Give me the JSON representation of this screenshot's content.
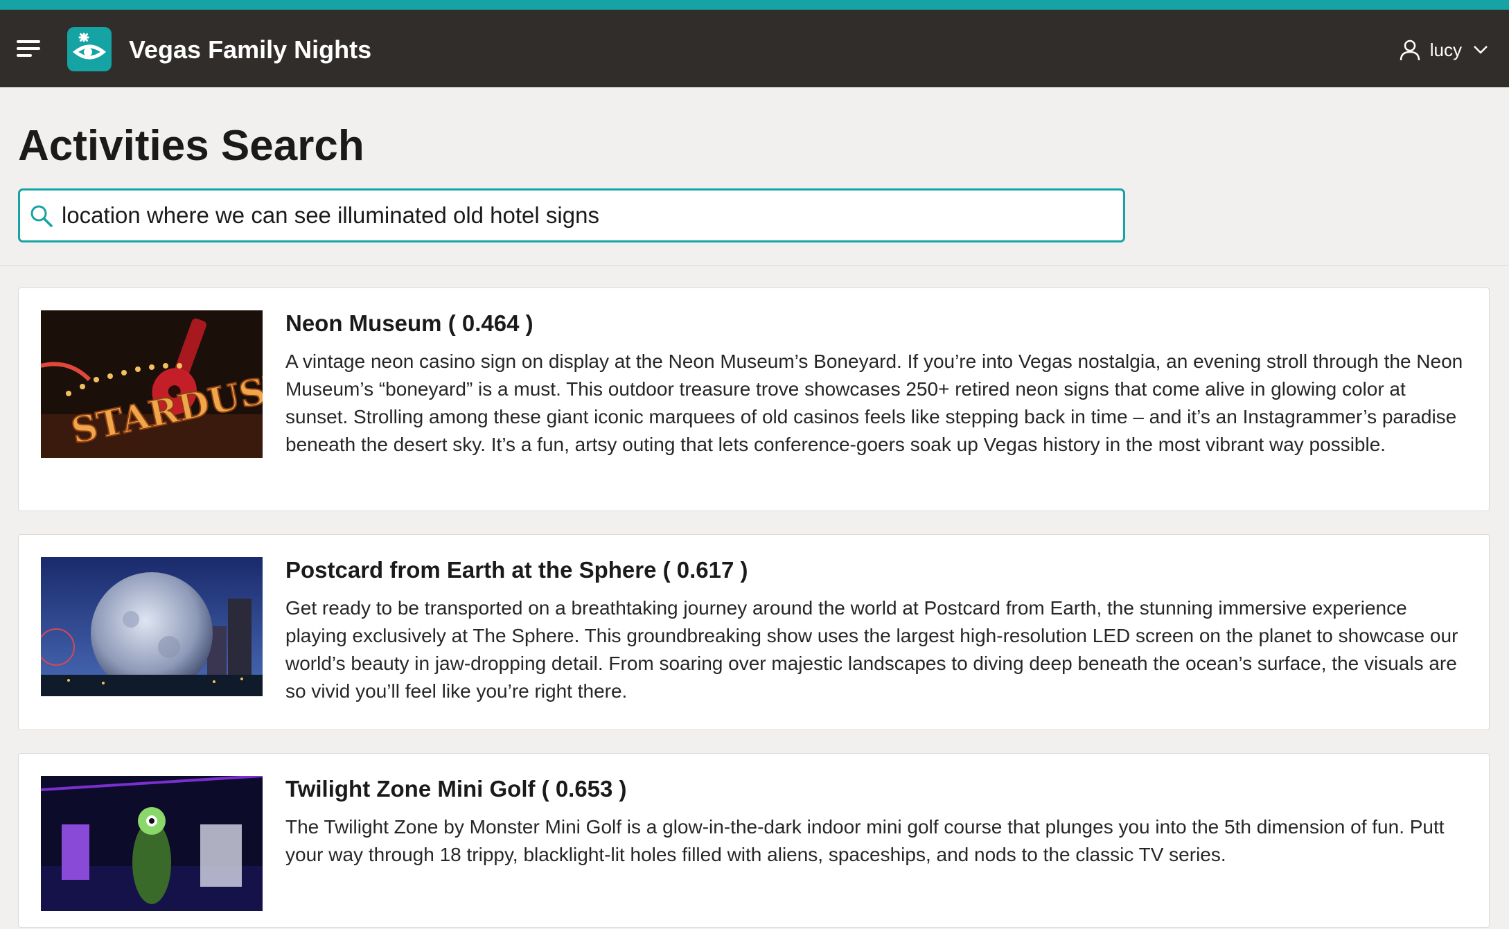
{
  "app": {
    "title": "Vegas Family Nights"
  },
  "user": {
    "name": "lucy"
  },
  "page": {
    "title": "Activities Search"
  },
  "search": {
    "value": "location where we can see illuminated old hotel signs"
  },
  "colors": {
    "accent": "#15a3a3",
    "header_bg": "#312d2a",
    "page_bg": "#f1f0ee"
  },
  "results": [
    {
      "title": "Neon Museum ( 0.464 )",
      "description": "A vintage neon casino sign on display at the Neon Museum’s Boneyard. If you’re into Vegas nostalgia, an evening stroll through the Neon Museum’s “boneyard” is a must. This outdoor treasure trove showcases 250+ retired neon signs that come alive in glowing color at sunset. Strolling among these giant iconic marquees of old casinos feels like stepping back in time – and it’s an Instagrammer’s paradise beneath the desert sky. It’s a fun, artsy outing that lets conference-goers soak up Vegas history in the most vibrant way possible.",
      "image_text": "STARDUST"
    },
    {
      "title": "Postcard from Earth at the Sphere ( 0.617 )",
      "description": "Get ready to be transported on a breathtaking journey around the world at Postcard from Earth, the stunning immersive experience playing exclusively at The Sphere. This groundbreaking show uses the largest high-resolution LED screen on the planet to showcase our world’s beauty in jaw-dropping detail. From soaring over majestic landscapes to diving deep beneath the ocean’s surface, the visuals are so vivid you’ll feel like you’re right there."
    },
    {
      "title": "Twilight Zone Mini Golf ( 0.653 )",
      "description": "The Twilight Zone by Monster Mini Golf is a glow-in-the-dark indoor mini golf course that plunges you into the 5th dimension of fun. Putt your way through 18 trippy, blacklight-lit holes filled with aliens, spaceships, and nods to the classic TV series."
    }
  ]
}
